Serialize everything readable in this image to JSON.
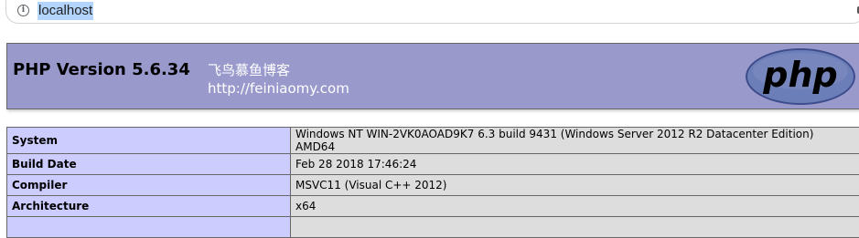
{
  "browser": {
    "url": "localhost"
  },
  "header": {
    "title": "PHP Version 5.6.34",
    "site_name": "飞鸟慕鱼博客",
    "site_url": "http://feiniaomy.com",
    "logo_text": "php"
  },
  "info_table": {
    "rows": [
      {
        "label": "System",
        "value": "Windows NT WIN-2VK0AOAD9K7 6.3 build 9431 (Windows Server 2012 R2 Datacenter Edition) AMD64"
      },
      {
        "label": "Build Date",
        "value": "Feb 28 2018 17:46:24"
      },
      {
        "label": "Compiler",
        "value": "MSVC11 (Visual C++ 2012)"
      },
      {
        "label": "Architecture",
        "value": "x64"
      }
    ]
  },
  "colors": {
    "header_bg": "#9999cc",
    "label_bg": "#ccccff",
    "value_bg": "#dddddd",
    "logo_bg": "#6c7eb7"
  }
}
